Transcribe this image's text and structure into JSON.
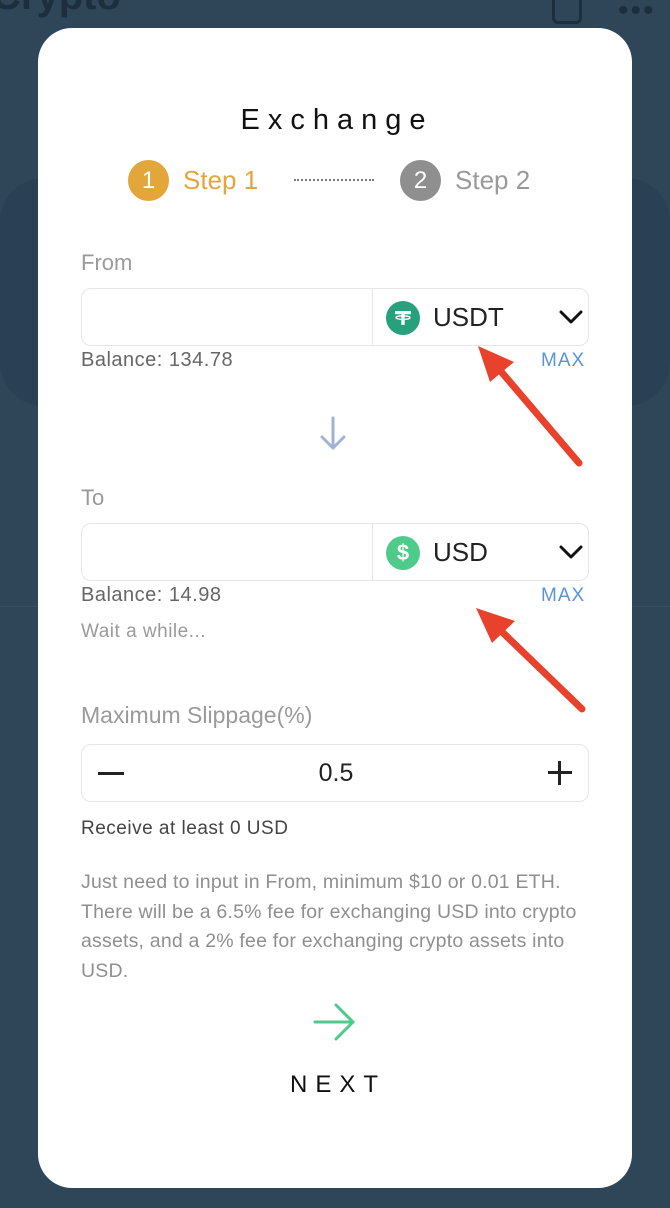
{
  "background": {
    "title": "Crypto",
    "icons": [
      "document-icon",
      "more-icon"
    ]
  },
  "modal": {
    "title": "Exchange",
    "steps": [
      {
        "number": "1",
        "label": "Step 1",
        "state": "active"
      },
      {
        "number": "2",
        "label": "Step 2",
        "state": "inactive"
      }
    ],
    "from": {
      "label": "From",
      "amount_value": "",
      "currency": "USDT",
      "currency_icon": "tether-icon",
      "balance": "Balance: 134.78",
      "max_label": "MAX"
    },
    "to": {
      "label": "To",
      "amount_value": "",
      "currency": "USD",
      "currency_icon": "dollar-icon",
      "balance": "Balance: 14.98",
      "max_label": "MAX"
    },
    "status_text": "Wait a while...",
    "slippage": {
      "label": "Maximum Slippage(%)",
      "value": "0.5"
    },
    "receive_text": "Receive at least 0 USD",
    "note": "Just need to input in From, minimum $10 or 0.01 ETH. There will be a 6.5% fee for exchanging USD into crypto assets, and a 2% fee for exchanging crypto assets into USD.",
    "next_label": "NEXT"
  },
  "colors": {
    "active_step": "#e3a63a",
    "inactive_step": "#8f8f8f",
    "link": "#5b93d9",
    "tether": "#26a17b",
    "dollar": "#4ecb8a",
    "next_arrow": "#4ecb8a",
    "annotation_arrow": "#e8412c",
    "backdrop": "#2f4558"
  }
}
